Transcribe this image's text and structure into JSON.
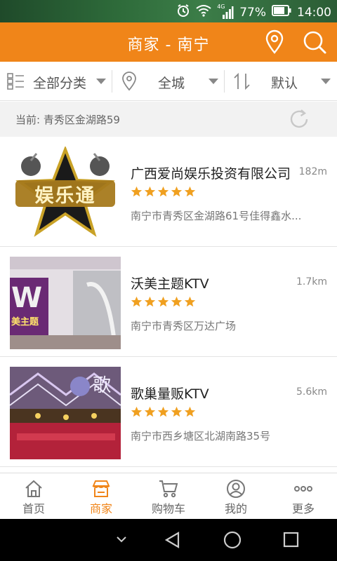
{
  "status_bar": {
    "network": "4G",
    "battery": "77%",
    "time": "14:00"
  },
  "header": {
    "title": "商家 - 南宁"
  },
  "filters": [
    {
      "label": "全部分类"
    },
    {
      "label": "全城"
    },
    {
      "label": "默认"
    }
  ],
  "current_location": "当前: 青秀区金湖路59",
  "merchants": [
    {
      "name": "广西爱尚娱乐投资有限公司",
      "distance": "182m",
      "rating": 5,
      "address": "南宁市青秀区金湖路61号佳得鑫水...",
      "thumb_text": "娱乐通"
    },
    {
      "name": "沃美主题KTV",
      "distance": "1.7km",
      "rating": 5,
      "address": "南宁市青秀区万达广场",
      "thumb_text": "美主题"
    },
    {
      "name": "歌巢量贩KTV",
      "distance": "5.6km",
      "rating": 5,
      "address": "南宁市西乡塘区北湖南路35号",
      "thumb_text": "歌"
    }
  ],
  "tabs": [
    {
      "label": "首页",
      "icon": "home-icon"
    },
    {
      "label": "商家",
      "icon": "shop-icon"
    },
    {
      "label": "购物车",
      "icon": "cart-icon"
    },
    {
      "label": "我的",
      "icon": "user-icon"
    },
    {
      "label": "更多",
      "icon": "more-icon"
    }
  ],
  "active_tab": 1,
  "colors": {
    "accent": "#f08519",
    "star": "#f0a020"
  }
}
